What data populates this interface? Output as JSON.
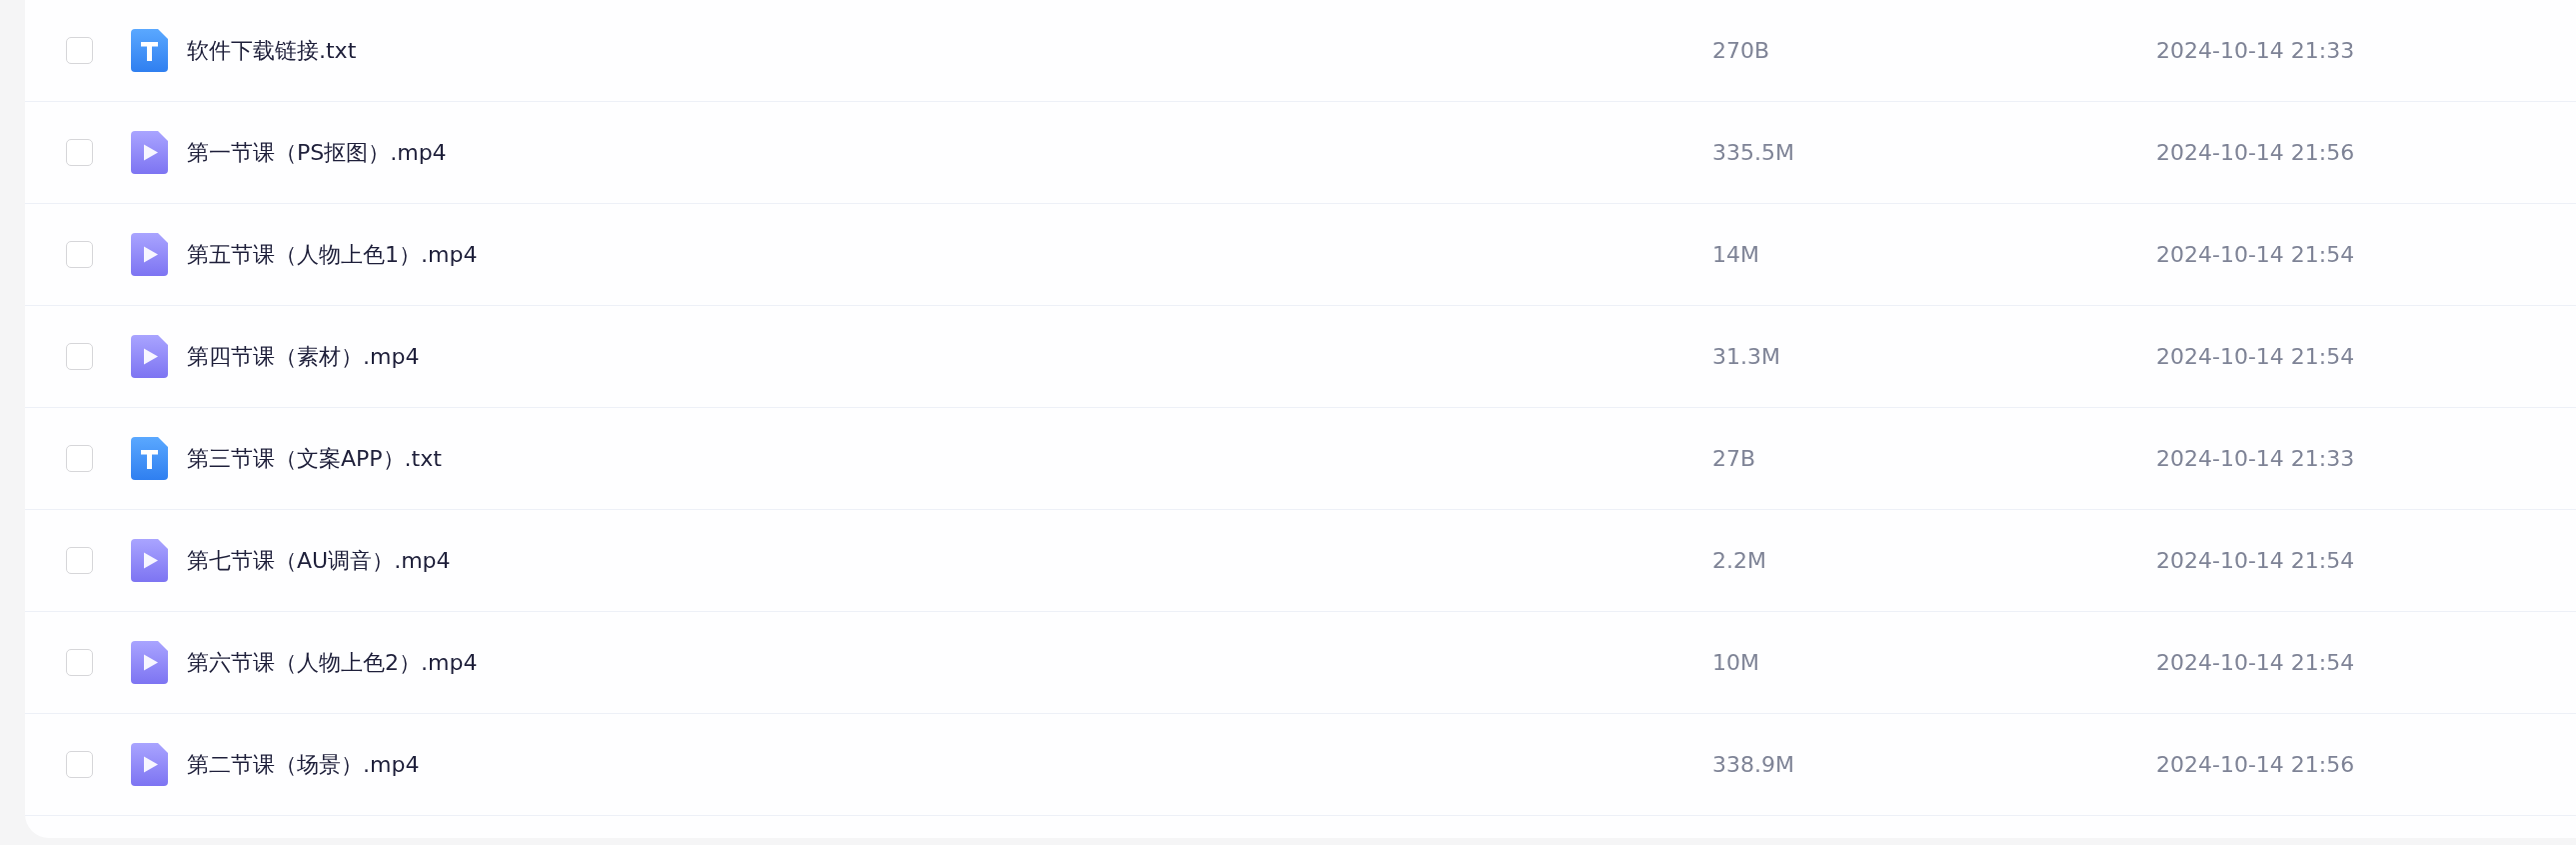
{
  "files": [
    {
      "kind": "text",
      "name": "软件下载链接.txt",
      "size": "270B",
      "modified": "2024-10-14 21:33",
      "checked": false
    },
    {
      "kind": "video",
      "name": "第一节课（PS抠图）.mp4",
      "size": "335.5M",
      "modified": "2024-10-14 21:56",
      "checked": false
    },
    {
      "kind": "video",
      "name": "第五节课（人物上色1）.mp4",
      "size": "14M",
      "modified": "2024-10-14 21:54",
      "checked": false
    },
    {
      "kind": "video",
      "name": "第四节课（素材）.mp4",
      "size": "31.3M",
      "modified": "2024-10-14 21:54",
      "checked": false
    },
    {
      "kind": "text",
      "name": "第三节课（文案APP）.txt",
      "size": "27B",
      "modified": "2024-10-14 21:33",
      "checked": false
    },
    {
      "kind": "video",
      "name": "第七节课（AU调音）.mp4",
      "size": "2.2M",
      "modified": "2024-10-14 21:54",
      "checked": false
    },
    {
      "kind": "video",
      "name": "第六节课（人物上色2）.mp4",
      "size": "10M",
      "modified": "2024-10-14 21:54",
      "checked": false
    },
    {
      "kind": "video",
      "name": "第二节课（场景）.mp4",
      "size": "338.9M",
      "modified": "2024-10-14 21:56",
      "checked": false
    }
  ]
}
